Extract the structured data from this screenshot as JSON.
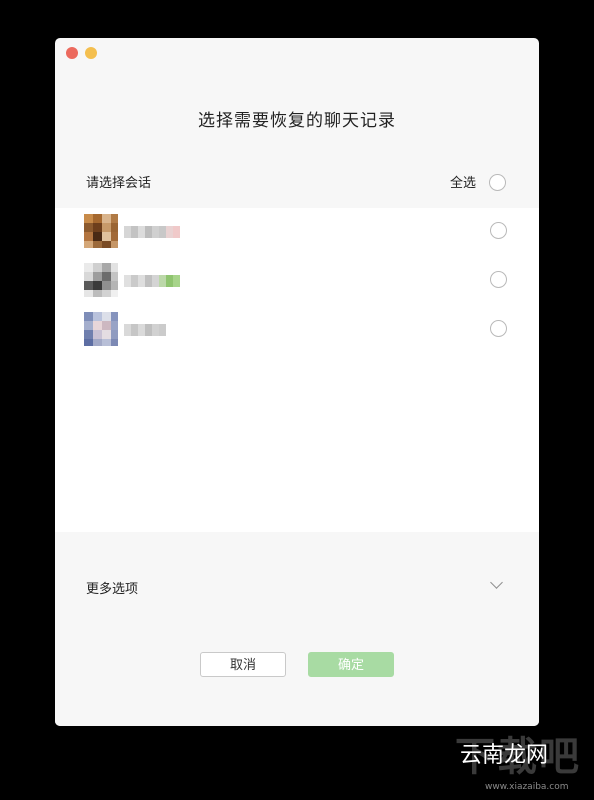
{
  "window": {
    "title": "选择需要恢复的聊天记录"
  },
  "selection": {
    "label": "请选择会话",
    "select_all_label": "全选"
  },
  "conversations": [
    {
      "avatar_colors": [
        [
          "#c88b4a",
          "#a5682f",
          "#d9b48c",
          "#b07a45"
        ],
        [
          "#8c5a2e",
          "#6e3f1c",
          "#c79a6a",
          "#9a6533"
        ],
        [
          "#b37540",
          "#4a2a14",
          "#e0c29e",
          "#a26a37"
        ],
        [
          "#d4a778",
          "#9c6a3b",
          "#7a4c25",
          "#c59667"
        ]
      ],
      "nickname_colors": [
        "#d6d6d6",
        "#c3c3c3",
        "#dcdcdc",
        "#bdbdbd",
        "#d0d0d0",
        "#c8c8c8",
        "#e9d2d2",
        "#f0c9c9"
      ]
    },
    {
      "avatar_colors": [
        [
          "#eaeaea",
          "#cfcfcf",
          "#a8a8a8",
          "#e2e2e2"
        ],
        [
          "#d8d8d8",
          "#9d9d9d",
          "#6c6c6c",
          "#c4c4c4"
        ],
        [
          "#5a5a5a",
          "#3a3a3a",
          "#8f8f8f",
          "#b5b5b5"
        ],
        [
          "#e6e6e6",
          "#bcbcbc",
          "#d2d2d2",
          "#f0f0f0"
        ]
      ],
      "nickname_colors": [
        "#e0e0e0",
        "#cacaca",
        "#dedede",
        "#c0c0c0",
        "#d4d4d4",
        "#bcd8a9",
        "#8fc46f",
        "#a7d48a"
      ]
    },
    {
      "avatar_colors": [
        [
          "#7e8db8",
          "#b9c2dc",
          "#dcdfe9",
          "#8593bd"
        ],
        [
          "#a4aecd",
          "#e8d6d9",
          "#cdb8c1",
          "#98a3c6"
        ],
        [
          "#6f7fae",
          "#c9c2d5",
          "#e4dde2",
          "#8f9bc0"
        ],
        [
          "#5d6ea3",
          "#a2a9c7",
          "#b8bfd7",
          "#7c89b4"
        ]
      ],
      "nickname_colors": [
        "#d9d9d9",
        "#c6c6c6",
        "#dadada",
        "#bfbfbf",
        "#d1d1d1",
        "#cbcbcb"
      ]
    }
  ],
  "more_options": {
    "label": "更多选项"
  },
  "buttons": {
    "cancel": "取消",
    "confirm": "确定"
  },
  "watermark": {
    "text": "下载吧",
    "site": "云南龙网",
    "url": "www.xiazaiba.com"
  }
}
